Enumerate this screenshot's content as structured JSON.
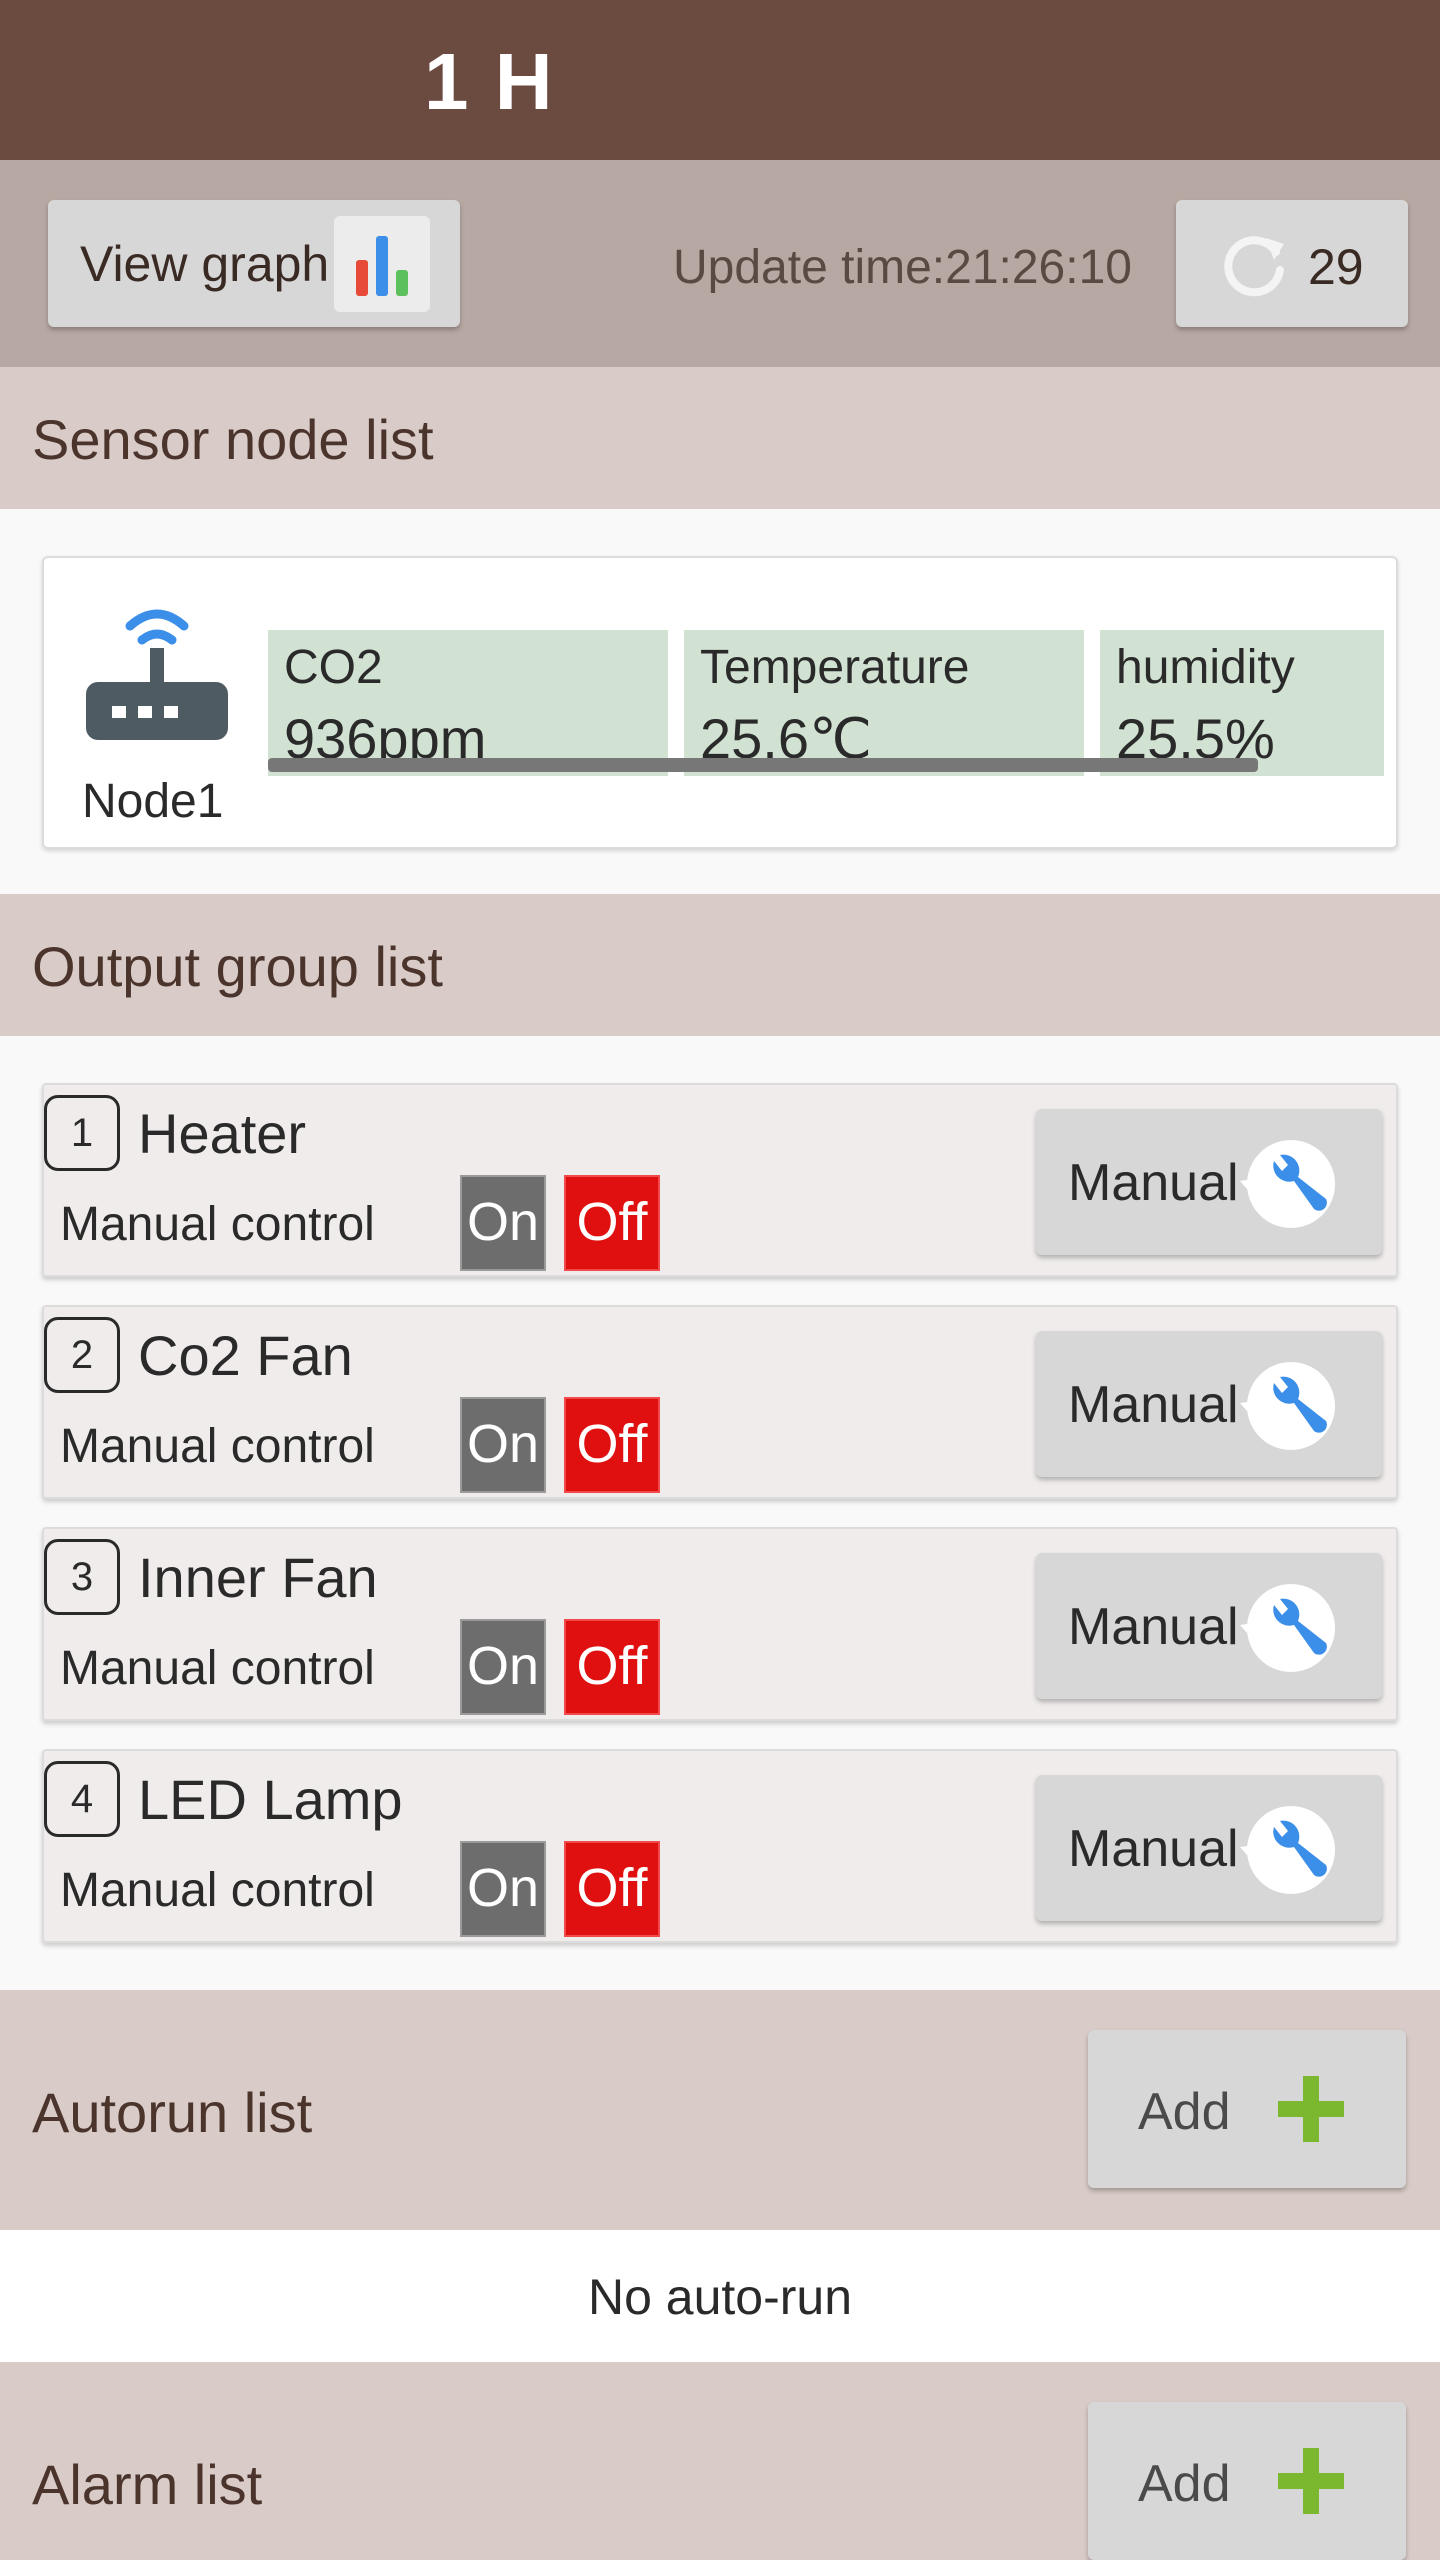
{
  "header": {
    "title": "1 H"
  },
  "toolbar": {
    "view_graph_label": "View graph",
    "update_time": "Update time:21:26:10",
    "refresh_count": "29"
  },
  "sensor_section": {
    "title": "Sensor node list",
    "node": {
      "label": "Node1",
      "sensors": [
        {
          "name": "CO2",
          "value": "936ppm"
        },
        {
          "name": "Temperature",
          "value": "25.6℃"
        },
        {
          "name": "humidity",
          "value": "25.5%"
        }
      ]
    }
  },
  "output_section": {
    "title": "Output group list",
    "items": [
      {
        "num": "1",
        "name": "Heater",
        "mode_label": "Manual control",
        "on": "On",
        "off": "Off",
        "button": "Manual"
      },
      {
        "num": "2",
        "name": "Co2 Fan",
        "mode_label": "Manual control",
        "on": "On",
        "off": "Off",
        "button": "Manual"
      },
      {
        "num": "3",
        "name": "Inner Fan",
        "mode_label": "Manual control",
        "on": "On",
        "off": "Off",
        "button": "Manual"
      },
      {
        "num": "4",
        "name": "LED Lamp",
        "mode_label": "Manual control",
        "on": "On",
        "off": "Off",
        "button": "Manual"
      }
    ]
  },
  "autorun_section": {
    "title": "Autorun list",
    "add_label": "Add",
    "empty_text": "No auto-run"
  },
  "alarm_section": {
    "title": "Alarm list",
    "add_label": "Add"
  },
  "colors": {
    "appbar": "#6b4a40",
    "toolbar": "#b8a8a3",
    "section_header": "#d9cbc7",
    "sensor_box": "#d1e2d3",
    "off_button": "#e01010",
    "on_button": "#6d6d6d",
    "add_plus": "#7cb82f",
    "wrench": "#3b8fe8"
  }
}
